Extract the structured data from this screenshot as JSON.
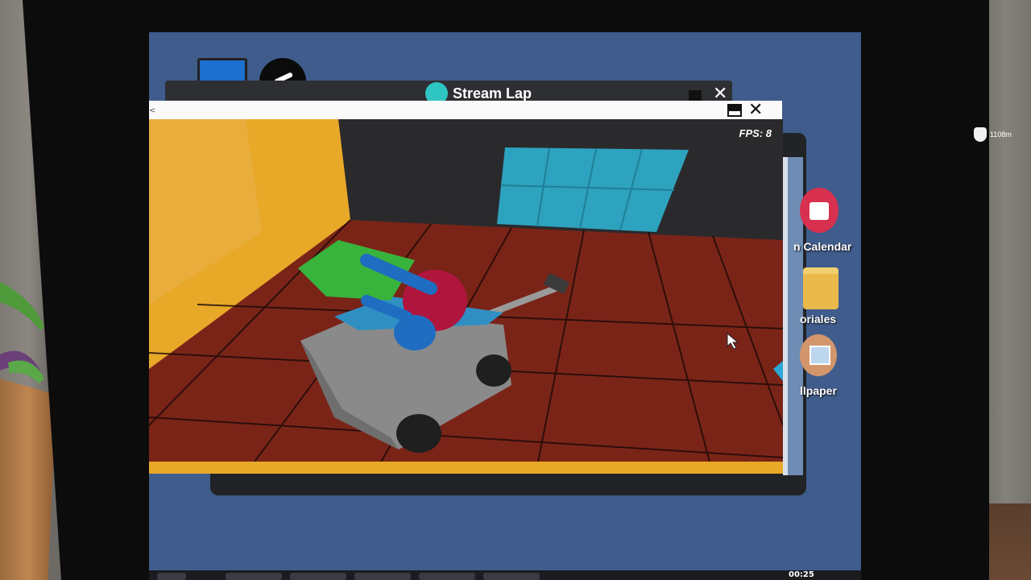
{
  "back_window": {
    "title": "Stream Lap"
  },
  "game": {
    "fps": "FPS: 8"
  },
  "desktop_icons": [
    {
      "label": "n Calendar",
      "icon": "calendar-icon"
    },
    {
      "label": "oriales",
      "icon": "folder-icon"
    },
    {
      "label": "llpaper",
      "icon": "wallpaper-icon"
    }
  ],
  "hud": {
    "distance": "1108m"
  },
  "taskbar": {
    "clock": "00:25"
  },
  "colors": {
    "desktop": "#405c8c",
    "floor": "#7a2418",
    "wall_orange": "#e8a828",
    "window_blue": "#2ea3bf"
  }
}
